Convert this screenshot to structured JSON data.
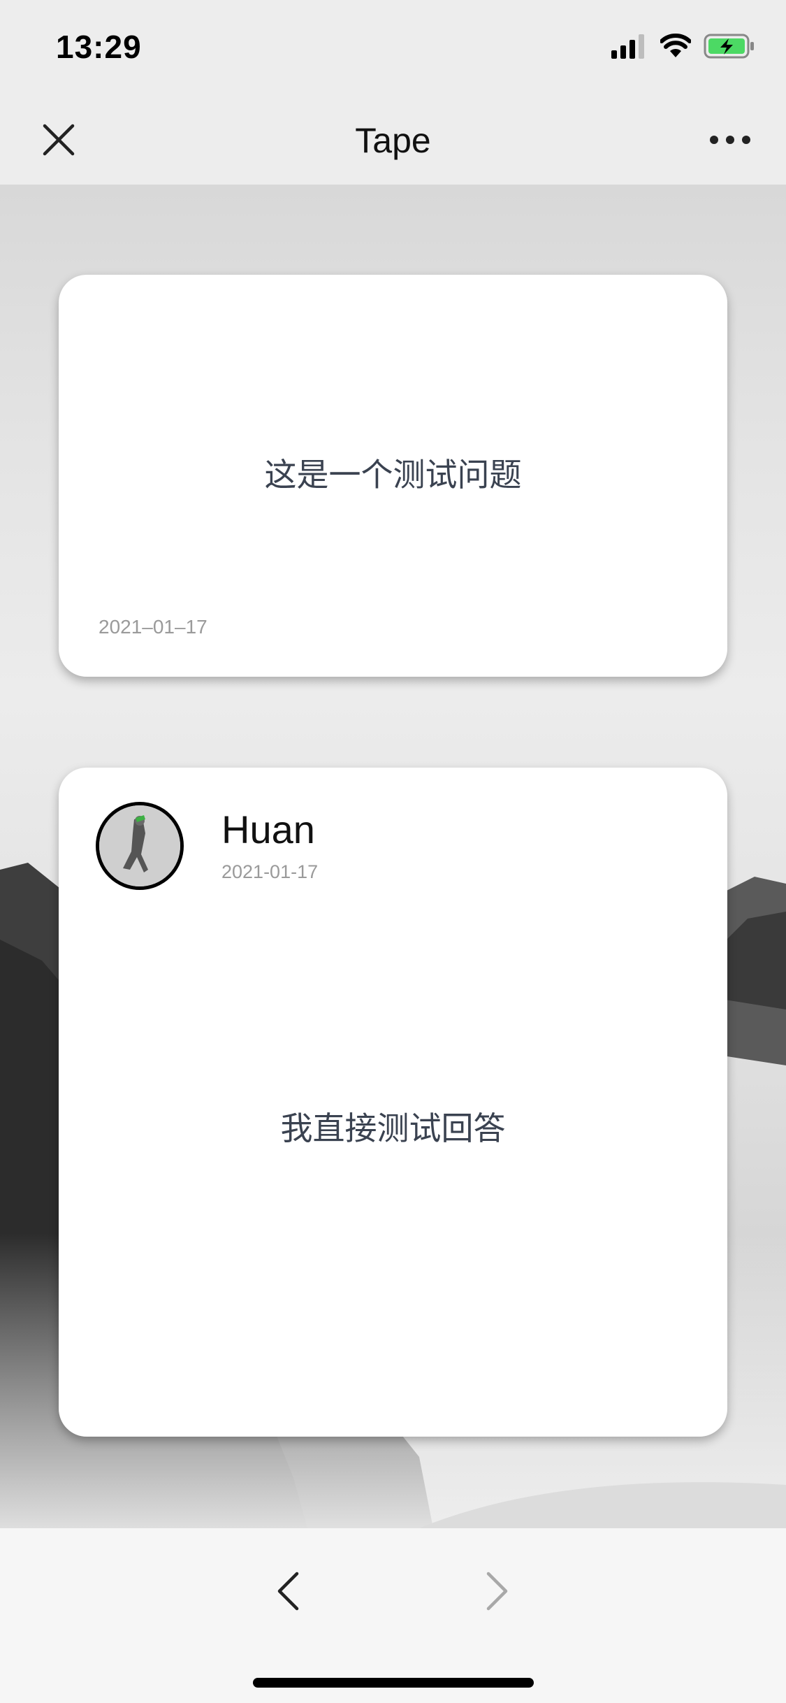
{
  "status_bar": {
    "time": "13:29"
  },
  "nav": {
    "title": "Tape",
    "close_icon": "close-icon",
    "more_icon": "more-icon"
  },
  "question_card": {
    "text": "这是一个测试问题",
    "date": "2021–01–17"
  },
  "answer_card": {
    "author": "Huan",
    "date": "2021-01-17",
    "text": "我直接测试回答"
  },
  "bottom_nav": {
    "prev_icon": "chevron-left-icon",
    "next_icon": "chevron-right-icon"
  },
  "colors": {
    "battery_fill": "#4cd964",
    "text_main": "#3a4250",
    "text_muted": "#9a9a9a"
  }
}
